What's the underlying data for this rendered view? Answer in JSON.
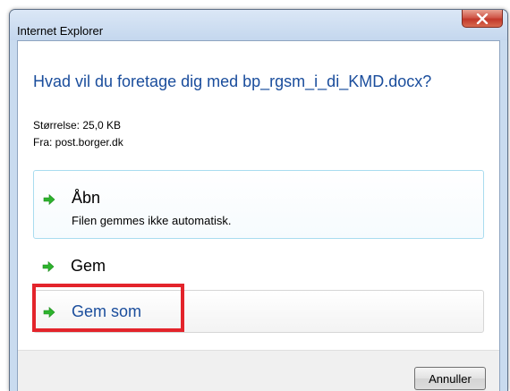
{
  "window": {
    "title": "Internet Explorer",
    "close_label": "X"
  },
  "dialog": {
    "question": "Hvad vil du foretage dig med bp_rgsm_i_di_KMD.docx?",
    "size": "Størrelse: 25,0 KB",
    "from": "Fra: post.borger.dk"
  },
  "options": {
    "open": {
      "label": "Åbn",
      "sub": "Filen gemmes ikke automatisk."
    },
    "save": {
      "label": "Gem"
    },
    "save_as": {
      "label": "Gem som"
    }
  },
  "footer": {
    "cancel_label": "Annuller"
  },
  "colors": {
    "question_text": "#1a4d9c",
    "save_as_text": "#1a4d9c",
    "arrow_green": "#2db32d",
    "highlight_red": "#e3242b"
  }
}
